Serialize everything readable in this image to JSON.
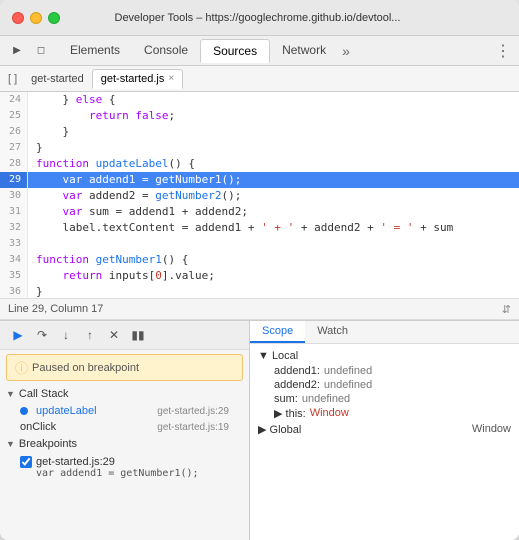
{
  "window": {
    "title": "Developer Tools – https://googlechrome.github.io/devtool..."
  },
  "traffic_lights": {
    "red": "red",
    "yellow": "yellow",
    "green": "green"
  },
  "toolbar": {
    "tabs": [
      {
        "label": "Elements",
        "active": false
      },
      {
        "label": "Console",
        "active": false
      },
      {
        "label": "Sources",
        "active": true
      },
      {
        "label": "Network",
        "active": false
      }
    ],
    "more_label": "»",
    "menu_label": "⋮"
  },
  "file_tabs": {
    "sidebar_toggle": "[ ]",
    "tabs": [
      {
        "label": "get-started",
        "closeable": false,
        "active": false
      },
      {
        "label": "get-started.js",
        "closeable": true,
        "active": true
      }
    ]
  },
  "code": {
    "lines": [
      {
        "num": "24",
        "text": "    } else {",
        "highlighted": false
      },
      {
        "num": "25",
        "text": "        return false;",
        "highlighted": false
      },
      {
        "num": "26",
        "text": "    }",
        "highlighted": false
      },
      {
        "num": "27",
        "text": "}",
        "highlighted": false
      },
      {
        "num": "28",
        "text": "function updateLabel() {",
        "highlighted": false
      },
      {
        "num": "29",
        "text": "    var addend1 = getNumber1();",
        "highlighted": true
      },
      {
        "num": "30",
        "text": "    var addend2 = getNumber2();",
        "highlighted": false
      },
      {
        "num": "31",
        "text": "    var sum = addend1 + addend2;",
        "highlighted": false
      },
      {
        "num": "32",
        "text": "    label.textContent = addend1 + ' + ' + addend2 + ' = ' + sum",
        "highlighted": false
      },
      {
        "num": "33",
        "text": "",
        "highlighted": false
      },
      {
        "num": "34",
        "text": "function getNumber1() {",
        "highlighted": false
      },
      {
        "num": "35",
        "text": "    return inputs[0].value;",
        "highlighted": false
      },
      {
        "num": "36",
        "text": "}",
        "highlighted": false
      }
    ]
  },
  "status_bar": {
    "text": "Line 29, Column 17"
  },
  "debug": {
    "pause_label": "Paused on breakpoint",
    "buttons": [
      "▶",
      "↺",
      "↓",
      "↑",
      "✕",
      "⏸"
    ],
    "call_stack_label": "▼ Call Stack",
    "stack_items": [
      {
        "name": "updateLabel",
        "file": "get-started.js:29",
        "current": true
      },
      {
        "name": "onClick",
        "file": "get-started.js:19",
        "current": false
      }
    ],
    "breakpoints_label": "▼ Breakpoints",
    "breakpoints": [
      {
        "name": "get-started.js:29",
        "checked": true,
        "code": "var addend1 = getNumber1();"
      }
    ]
  },
  "scope": {
    "tabs": [
      {
        "label": "Scope",
        "active": true
      },
      {
        "label": "Watch",
        "active": false
      }
    ],
    "local_label": "▼ Local",
    "properties": [
      {
        "name": "addend1:",
        "value": "undefined"
      },
      {
        "name": "addend2:",
        "value": "undefined"
      },
      {
        "name": "sum:",
        "value": "undefined"
      },
      {
        "name": "▶ this:",
        "value": "Window"
      }
    ],
    "global_label": "▶ Global",
    "global_value": "Window"
  }
}
